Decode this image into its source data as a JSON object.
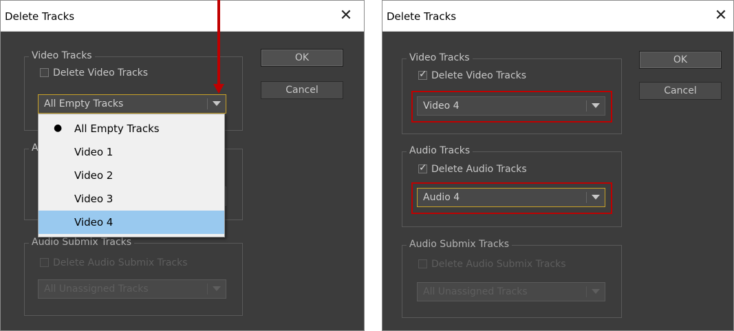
{
  "left_dialog": {
    "title": "Delete Tracks",
    "close_glyph": "✕",
    "video_group": {
      "legend": "Video Tracks",
      "checkbox_label": "Delete Video Tracks",
      "checked": false,
      "select_value": "All Empty Tracks"
    },
    "audio_group_legend_visible": "A",
    "submix_group": {
      "legend": "Audio Submix Tracks",
      "checkbox_label": "Delete Audio Submix Tracks",
      "checked": false,
      "select_value": "All Unassigned Tracks",
      "enabled": false
    },
    "ok_label": "OK",
    "cancel_label": "Cancel",
    "dropdown": {
      "items": [
        "All Empty Tracks",
        "Video 1",
        "Video 2",
        "Video 3",
        "Video 4"
      ],
      "selected_bullet_index": 0,
      "highlighted_index": 4
    }
  },
  "right_dialog": {
    "title": "Delete Tracks",
    "close_glyph": "✕",
    "video_group": {
      "legend": "Video Tracks",
      "checkbox_label": "Delete Video Tracks",
      "checked": true,
      "select_value": "Video 4"
    },
    "audio_group": {
      "legend": "Audio Tracks",
      "checkbox_label": "Delete Audio Tracks",
      "checked": true,
      "select_value": "Audio 4"
    },
    "submix_group": {
      "legend": "Audio Submix Tracks",
      "checkbox_label": "Delete Audio Submix Tracks",
      "checked": false,
      "select_value": "All Unassigned Tracks",
      "enabled": false
    },
    "ok_label": "OK",
    "cancel_label": "Cancel"
  },
  "glyphs": {
    "check": "✓",
    "bullet": "●"
  },
  "colors": {
    "dialog_bg": "#3c3c3c",
    "highlight": "#99c9ef",
    "annotation_red": "#c00000",
    "focus_border": "#c9a227"
  }
}
